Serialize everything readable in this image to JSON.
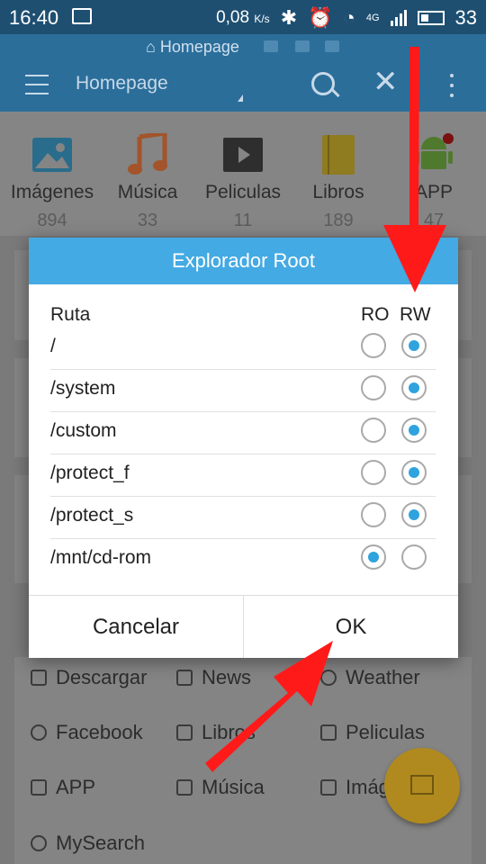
{
  "status": {
    "time": "16:40",
    "speed": "0,08",
    "speed_unit": "K/s",
    "net": "4G",
    "battery": "33"
  },
  "address": {
    "label": "Homepage"
  },
  "toolbar": {
    "title": "Homepage"
  },
  "categories": [
    {
      "name": "Imágenes",
      "count": "894",
      "icon": "image-icon",
      "color": "#2a6c8b"
    },
    {
      "name": "Música",
      "count": "33",
      "icon": "music-note-icon",
      "color": "#a3542a"
    },
    {
      "name": "Peliculas",
      "count": "11",
      "icon": "video-play-icon",
      "color": "#2e2e2e"
    },
    {
      "name": "Libros",
      "count": "189",
      "icon": "book-icon",
      "color": "#8f7b20"
    },
    {
      "name": "APP",
      "count": "47",
      "icon": "android-icon",
      "color": "#4f7a2e"
    }
  ],
  "dialog": {
    "title": "Explorador Root",
    "col_path": "Ruta",
    "col_ro": "RO",
    "col_rw": "RW",
    "rows": [
      {
        "path": "/",
        "mode": "rw"
      },
      {
        "path": "/system",
        "mode": "rw"
      },
      {
        "path": "/custom",
        "mode": "rw"
      },
      {
        "path": "/protect_f",
        "mode": "rw"
      },
      {
        "path": "/protect_s",
        "mode": "rw"
      },
      {
        "path": "/mnt/cd-rom",
        "mode": "ro"
      }
    ],
    "cancel": "Cancelar",
    "ok": "OK"
  },
  "links": [
    {
      "label": "Descargar",
      "icon": "download-icon"
    },
    {
      "label": "News",
      "icon": "news-icon"
    },
    {
      "label": "Weather",
      "icon": "weather-icon"
    },
    {
      "label": "Facebook",
      "icon": "globe-icon"
    },
    {
      "label": "Libros",
      "icon": "book-icon"
    },
    {
      "label": "Peliculas",
      "icon": "video-icon"
    },
    {
      "label": "APP",
      "icon": "app-icon"
    },
    {
      "label": "Música",
      "icon": "music-icon"
    },
    {
      "label": "Imágenes",
      "icon": "image-icon"
    },
    {
      "label": "MySearch",
      "icon": "globe-icon"
    }
  ],
  "colors": {
    "accent": "#44aae3",
    "radio_on": "#2ea3de",
    "arrow": "#ff1a1a",
    "fab": "#b08a1e"
  }
}
